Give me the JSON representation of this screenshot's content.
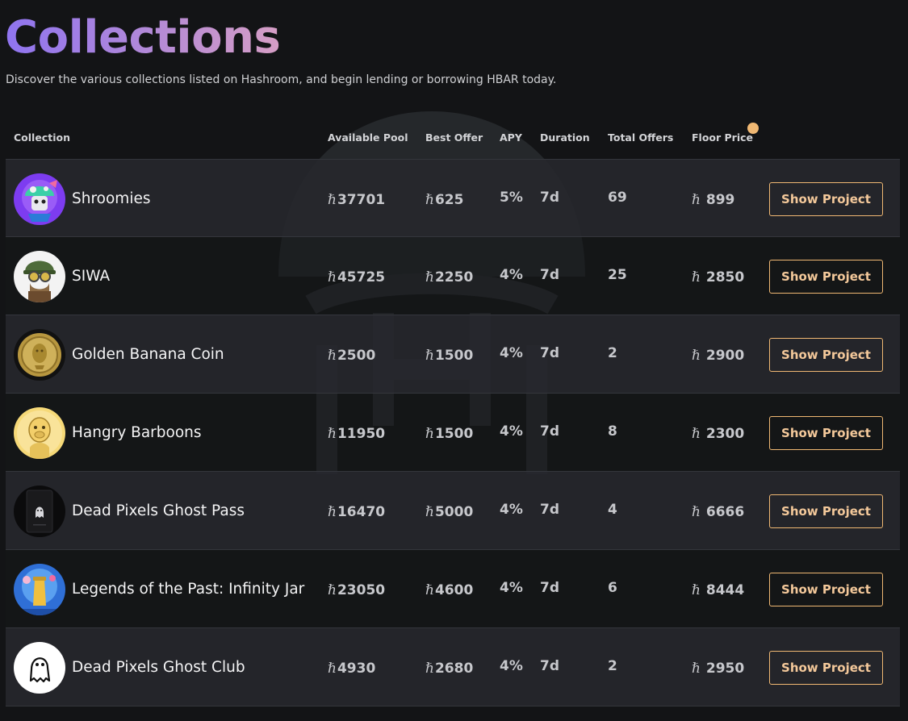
{
  "header": {
    "title": "Collections",
    "subtitle": "Discover the various collections listed on Hashroom, and begin lending or borrowing HBAR today."
  },
  "columns": {
    "collection": "Collection",
    "available_pool": "Available Pool",
    "best_offer": "Best Offer",
    "apy": "APY",
    "duration": "Duration",
    "total_offers": "Total Offers",
    "floor_price": "Floor Price"
  },
  "currency_symbol": "ℏ",
  "button_label": "Show Project",
  "colors": {
    "accent": "#f0b873",
    "title_gradient_start": "#8f74f0",
    "title_gradient_end": "#d69ec5",
    "background": "#131416"
  },
  "rows": [
    {
      "name": "Shroomies",
      "pool": "37701",
      "best": "625",
      "apy": "5%",
      "duration": "7d",
      "offers": "69",
      "floor": " 899",
      "avatar": "shroomies-avatar"
    },
    {
      "name": "SIWA",
      "pool": "45725",
      "best": "2250",
      "apy": "4%",
      "duration": "7d",
      "offers": "25",
      "floor": " 2850",
      "avatar": "siwa-avatar"
    },
    {
      "name": "Golden Banana Coin",
      "pool": "2500",
      "best": "1500",
      "apy": "4%",
      "duration": "7d",
      "offers": "2",
      "floor": " 2900",
      "avatar": "golden-coin-avatar"
    },
    {
      "name": "Hangry Barboons",
      "pool": "11950",
      "best": "1500",
      "apy": "4%",
      "duration": "7d",
      "offers": "8",
      "floor": " 2300",
      "avatar": "baboon-avatar"
    },
    {
      "name": "Dead Pixels Ghost Pass",
      "pool": "16470",
      "best": "5000",
      "apy": "4%",
      "duration": "7d",
      "offers": "4",
      "floor": " 6666",
      "avatar": "ghost-pass-avatar"
    },
    {
      "name": "Legends of the Past: Infinity Jar",
      "pool": "23050",
      "best": "4600",
      "apy": "4%",
      "duration": "7d",
      "offers": "6",
      "floor": " 8444",
      "avatar": "infinity-jar-avatar"
    },
    {
      "name": "Dead Pixels Ghost Club",
      "pool": "4930",
      "best": "2680",
      "apy": "4%",
      "duration": "7d",
      "offers": "2",
      "floor": " 2950",
      "avatar": "ghost-club-avatar"
    }
  ]
}
